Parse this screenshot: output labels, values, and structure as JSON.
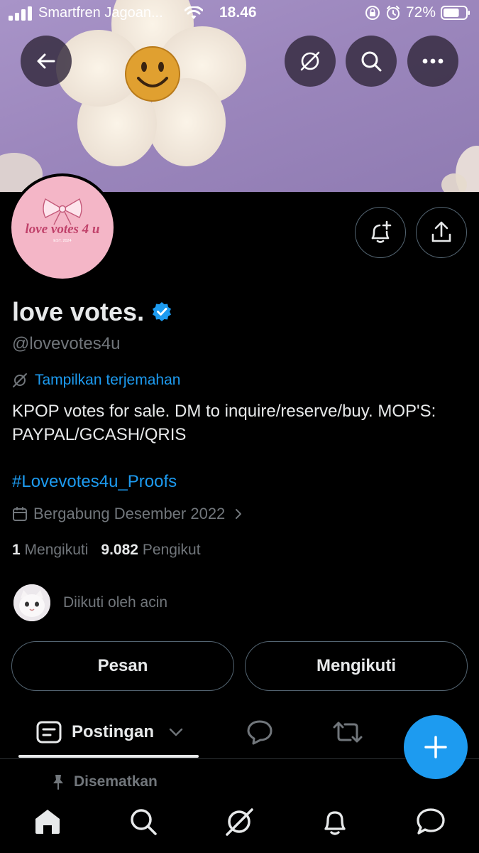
{
  "status_bar": {
    "carrier": "Smartfren Jagoan...",
    "time": "18.46",
    "battery": "72%",
    "battery_level": 0.72
  },
  "profile": {
    "name": "love votes.",
    "handle": "@lovevotes4u",
    "translate_label": "Tampilkan terjemahan",
    "bio": "KPOP votes for sale. DM to inquire/reserve/buy. MOP'S: PAYPAL/GCASH/QRIS",
    "hashtag": "#Lovevotes4u_Proofs",
    "joined": "Bergabung Desember 2022",
    "following_count": "1",
    "following_label": "Mengikuti",
    "followers_count": "9.082",
    "followers_label": "Pengikut",
    "followed_by": "Diikuti oleh acin",
    "avatar_text": "love votes 4 u",
    "avatar_subtext": "EST. 2024"
  },
  "actions": {
    "message_label": "Pesan",
    "following_button_label": "Mengikuti"
  },
  "tabs": {
    "posts_label": "Postingan"
  },
  "pinned_label": "Disematkan",
  "colors": {
    "accent": "#1d9bf0",
    "background": "#000000",
    "text_primary": "#e7e9ea",
    "text_secondary": "#71767b",
    "border": "#536471",
    "avatar_pink": "#f4b6c7",
    "banner_purple": "#9c87bd"
  },
  "icons": {
    "back": "arrow-left-icon",
    "grok": "grok-icon",
    "search": "search-icon",
    "more": "more-icon",
    "notify": "bell-plus-icon",
    "share": "share-icon",
    "verified": "verified-badge-icon",
    "calendar": "calendar-icon",
    "compose": "plus-icon",
    "pin": "pin-icon"
  }
}
